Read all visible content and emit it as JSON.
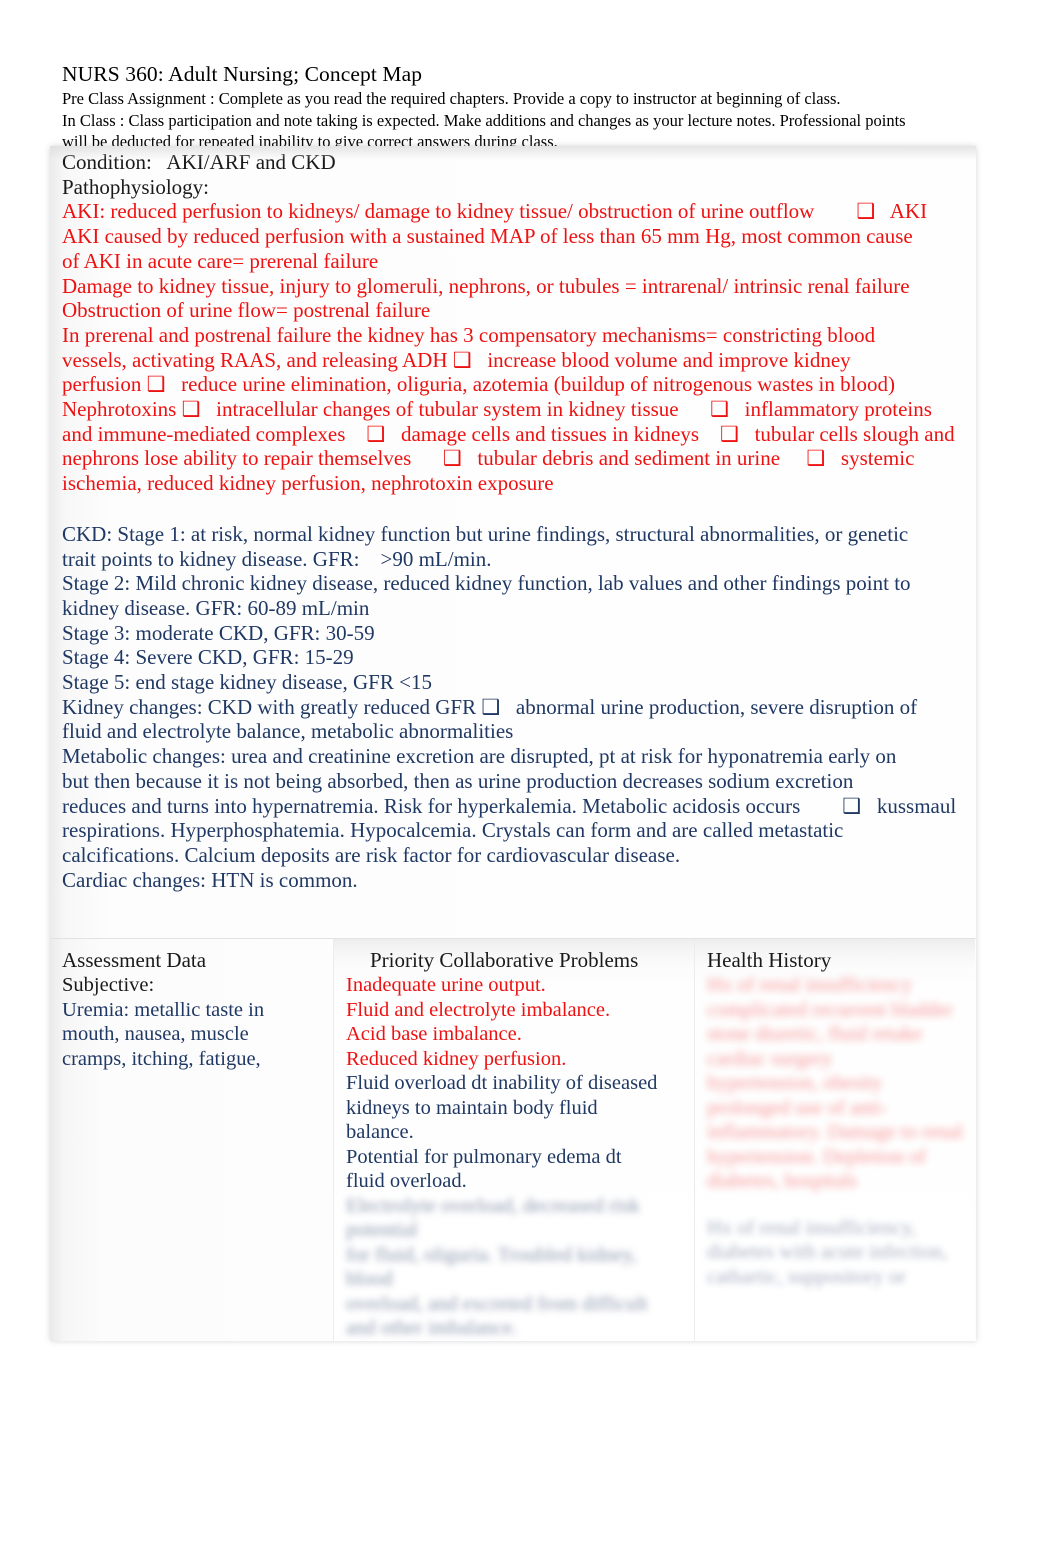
{
  "header": {
    "title": "NURS 360: Adult Nursing; Concept Map",
    "pre_class": "Pre Class Assignment    : Complete as you read the required chapters. Provide a copy to instructor at beginning of class.",
    "in_class_1": "In Class : Class participation and note taking is expected. Make additions and changes as your lecture notes. Professional points",
    "in_class_2": "will be deducted for repeated inability to give correct answers during class."
  },
  "condition": {
    "condition_label": "Condition:   AKI/ARF and CKD",
    "patho_label": "Pathophysiology:",
    "aki_lines": [
      "AKI: reduced perfusion to kidneys/ damage to kidney tissue/ obstruction of urine outflow        ❑   AKI",
      "AKI caused by reduced perfusion with a sustained MAP of less than 65 mm Hg, most common cause",
      "of AKI in acute care= prerenal failure",
      "Damage to kidney tissue, injury to glomeruli, nephrons, or tubules = intrarenal/ intrinsic renal failure",
      "Obstruction of urine flow= postrenal failure",
      "In prerenal and postrenal failure the kidney has 3 compensatory mechanisms= constricting blood",
      "vessels, activating RAAS, and releasing ADH ❑   increase blood volume and improve kidney",
      "perfusion ❑   reduce urine elimination, oliguria, azotemia (buildup of nitrogenous wastes in blood)",
      "Nephrotoxins ❑   intracellular changes of tubular system in kidney tissue      ❑   inflammatory proteins",
      "and immune-mediated complexes    ❑   damage cells and tissues in kidneys    ❑   tubular cells slough and",
      "nephrons lose ability to repair themselves      ❑   tubular debris and sediment in urine     ❑   systemic",
      "ischemia, reduced kidney perfusion, nephrotoxin exposure"
    ],
    "ckd_lines": [
      "CKD: Stage 1: at risk, normal kidney function but urine findings, structural abnormalities, or genetic",
      "trait points to kidney disease. GFR:    >90 mL/min.",
      "Stage 2: Mild chronic kidney disease, reduced kidney function, lab values and other findings point to",
      "kidney disease. GFR: 60-89 mL/min",
      "Stage 3: moderate CKD, GFR: 30-59",
      "Stage 4: Severe CKD, GFR: 15-29",
      "Stage 5: end stage kidney disease, GFR <15",
      "Kidney changes: CKD with greatly reduced GFR ❑   abnormal urine production, severe disruption of",
      "fluid and electrolyte balance, metabolic abnormalities",
      "Metabolic changes: urea and creatinine excretion are disrupted, pt at risk for hyponatremia early on",
      "but then because it is not being absorbed, then as urine production decreases sodium excretion",
      "reduces and turns into hypernatremia. Risk for hyperkalemia. Metabolic acidosis occurs        ❑   kussmaul",
      "respirations. Hyperphosphatemia. Hypocalcemia. Crystals can form and are called metastatic",
      "calcifications. Calcium deposits are risk factor for cardiovascular disease.",
      "Cardiac changes: HTN is common."
    ]
  },
  "assessment": {
    "heading": "Assessment Data",
    "subjective_label": "Subjective:",
    "lines": [
      "Uremia: metallic taste in",
      "mouth, nausea, muscle",
      "cramps, itching, fatigue,"
    ]
  },
  "priority": {
    "heading": "Priority Collaborative Problems",
    "red_lines": [
      "Inadequate urine output.",
      "Fluid and electrolyte imbalance.",
      "Acid base imbalance.",
      "Reduced kidney perfusion."
    ],
    "navy_lines": [
      "Fluid overload dt inability of diseased",
      "kidneys to maintain body fluid",
      "balance.",
      "Potential for pulmonary edema dt",
      "fluid overload."
    ],
    "redacted_lines": [
      "Electrolyte overload, decreased risk potential",
      "for fluid, oliguria. Troubled kidney, blood",
      "overload, and excreted from difficult",
      "and other imbalance."
    ]
  },
  "history": {
    "heading": "Health History",
    "redacted_red_lines": [
      "Hx of renal insufficiency",
      "complicated recurrent bladder",
      "stone diuretic, fluid retake",
      "cardiac surgery",
      "hypertension, obesity",
      "prolonged use of anti-",
      "inflammatory. Damage to renal",
      "hypertension. Depletion of",
      "diabetes, hospitals"
    ],
    "redacted_navy_lines": [
      "Hx of renal insufficiency,",
      "diabetes with acute infection,",
      "cathartic, suppository or"
    ]
  }
}
